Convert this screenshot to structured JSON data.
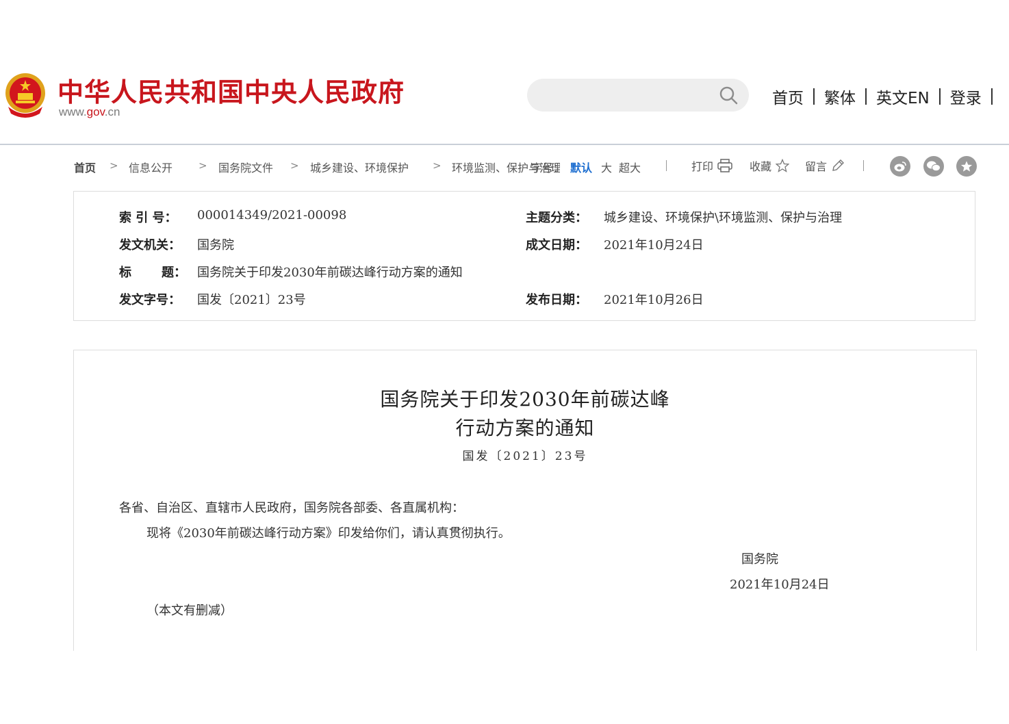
{
  "header": {
    "site_title": "中华人民共和国中央人民政府",
    "site_url_pre": "www.",
    "site_url_brand": "gov",
    "site_url_post": ".cn",
    "search_placeholder": "",
    "nav": [
      {
        "label": "首页"
      },
      {
        "label": "繁体"
      },
      {
        "label": "英文EN"
      },
      {
        "label": "登录"
      }
    ]
  },
  "breadcrumb": {
    "items": [
      "首页",
      "信息公开",
      "国务院文件",
      "城乡建设、环境保护",
      "环境监测、保护与治理"
    ],
    "font_label": "字号：",
    "font_options": [
      "默认",
      "大",
      "超大"
    ],
    "tools": {
      "print": "打印",
      "favorite": "收藏",
      "comment": "留言"
    }
  },
  "metadata": {
    "index_no_label": "索 引 号：",
    "index_no": "000014349/2021-00098",
    "category_label": "主题分类：",
    "category": "城乡建设、环境保护\\环境监测、保护与治理",
    "issuer_label": "发文机关：",
    "issuer": "国务院",
    "written_date_label": "成文日期：",
    "written_date": "2021年10月24日",
    "title_label_a": "标",
    "title_label_b": "题：",
    "title": "国务院关于印发2030年前碳达峰行动方案的通知",
    "doc_no_label": "发文字号：",
    "doc_no": "国发〔2021〕23号",
    "publish_date_label": "发布日期：",
    "publish_date": "2021年10月26日"
  },
  "article": {
    "title_line1": "国务院关于印发2030年前碳达峰",
    "title_line2": "行动方案的通知",
    "doc_no": "国发〔2021〕23号",
    "addressee": "各省、自治区、直辖市人民政府，国务院各部委、各直属机构：",
    "body": "现将《2030年前碳达峰行动方案》印发给你们，请认真贯彻执行。",
    "signatory": "国务院",
    "sign_date": "2021年10月24日",
    "note": "（本文有删减）"
  },
  "colors": {
    "brand_red": "#c8161d",
    "active_blue": "#1f6fd0",
    "icon_gray": "#9a9a9a"
  }
}
